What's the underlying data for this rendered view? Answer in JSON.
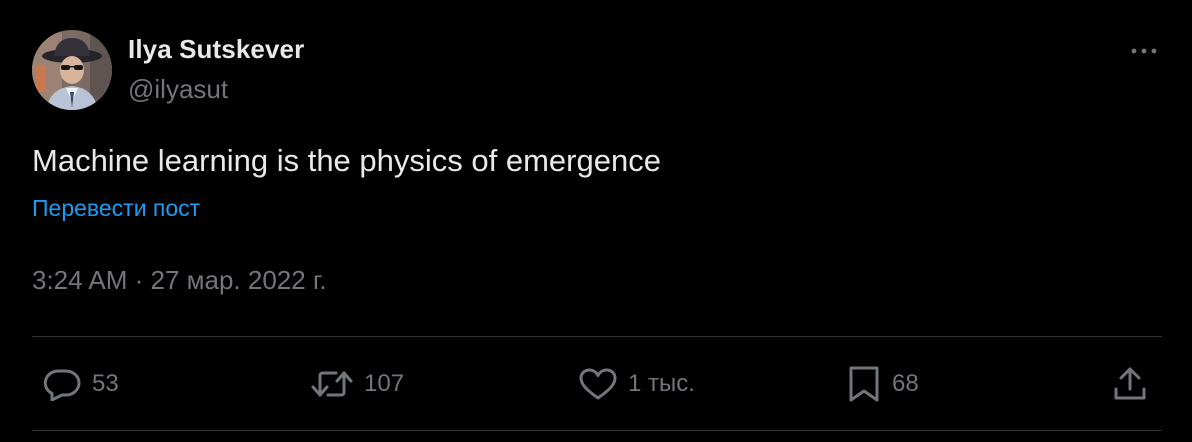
{
  "author": {
    "display_name": "Ilya Sutskever",
    "handle": "@ilyasut",
    "avatar_icon": "profile-photo"
  },
  "tweet": {
    "text": "Machine learning is the physics of emergence",
    "translate_label": "Перевести пост",
    "timestamp": "3:24 AM · 27 мар. 2022 г."
  },
  "actions": {
    "reply": {
      "icon": "reply-icon",
      "count": "53"
    },
    "retweet": {
      "icon": "retweet-icon",
      "count": "107"
    },
    "like": {
      "icon": "heart-icon",
      "count": "1 тыс."
    },
    "bookmark": {
      "icon": "bookmark-icon",
      "count": "68"
    },
    "share": {
      "icon": "share-icon"
    }
  },
  "colors": {
    "background": "#000000",
    "primary_text": "#e7e9ea",
    "secondary_text": "#71767b",
    "link": "#1d9bf0",
    "divider": "#2f3336"
  }
}
